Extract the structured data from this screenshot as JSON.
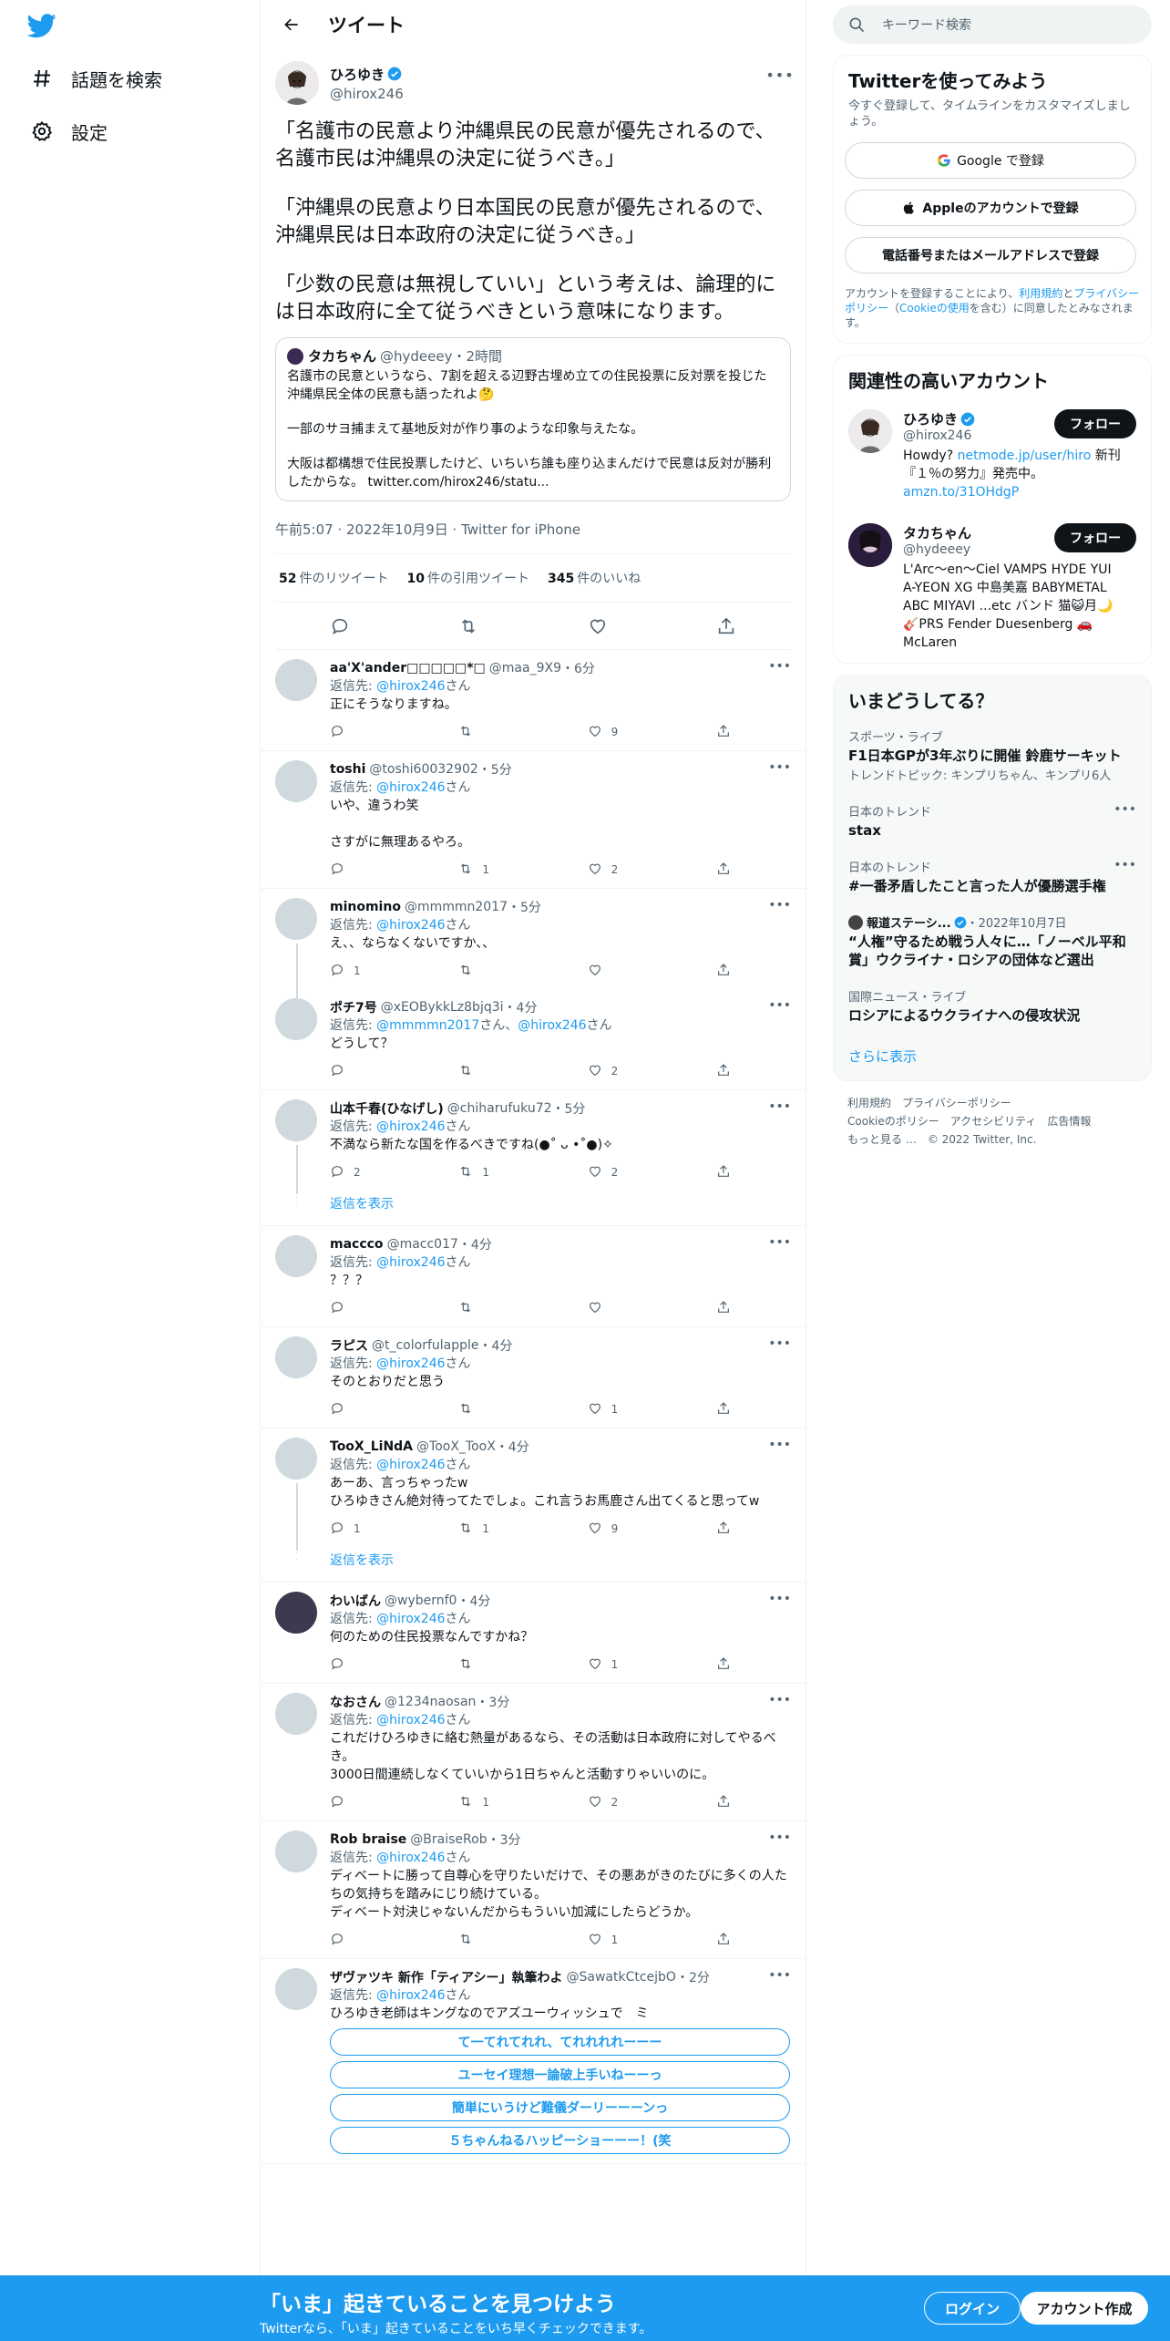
{
  "nav": {
    "items": [
      {
        "label": "話題を検索"
      },
      {
        "label": "設定"
      }
    ]
  },
  "header": {
    "title": "ツイート"
  },
  "focal": {
    "name": "ひろゆき",
    "handle": "@hirox246",
    "paragraphs": [
      "「名護市の民意より沖縄県民の民意が優先されるので、名護市民は沖縄県の決定に従うべき。」",
      "「沖縄県の民意より日本国民の民意が優先されるので、沖縄県民は日本政府の決定に従うべき。」",
      "「少数の民意は無視していい」という考えは、論理的には日本政府に全て従うべきという意味になります。"
    ],
    "quote": {
      "name": "タカちゃん",
      "handle": "@hydeeey",
      "time": "・2時間",
      "p1": "名護市の民意というなら、7割を超える辺野古埋め立ての住民投票に反対票を投じた沖縄県民全体の民意も語ったれよ🤔",
      "p2": "一部のサヨ捕まえて基地反対が作り事のような印象与えたな。",
      "p3": "大阪は都構想で住民投票したけど、いちいち誰も座り込まんだけで民意は反対が勝利したからな。 twitter.com/hirox246/statu..."
    },
    "timestamp": "午前5:07 · 2022年10月9日 · Twitter for iPhone",
    "retweets": "52",
    "retweets_label": "件のリツイート",
    "quotes": "10",
    "quotes_label": "件の引用ツイート",
    "likes": "345",
    "likes_label": "件のいいね"
  },
  "reply_to_label": "返信先:",
  "san": "さん",
  "show_replies": "返信を表示",
  "replies": [
    {
      "name": "aa'X'ander□□□□□*□",
      "handle": "@maa_9X9",
      "time": "・6分",
      "to": "@hirox246",
      "text": "正にそうなりますね。",
      "reply": "",
      "retweet": "",
      "like": "9"
    },
    {
      "name": "toshi",
      "handle": "@toshi60032902",
      "time": "・5分",
      "to": "@hirox246",
      "text": "いや、違うわ笑\n\nさすがに無理あるやろ。",
      "reply": "",
      "retweet": "1",
      "like": "2"
    },
    {
      "name": "minomino",
      "handle": "@mmmmn2017",
      "time": "・5分",
      "to": "@hirox246",
      "text": "え、、ならなくないですか、、",
      "reply": "1",
      "retweet": "",
      "like": ""
    },
    {
      "name": "ポチ7号",
      "handle": "@xEOBykkLz8bjq3i",
      "time": "・4分",
      "to": "@mmmmn2017",
      "to2": "@hirox246",
      "text": "どうして？",
      "reply": "",
      "retweet": "",
      "like": "2"
    },
    {
      "name": "山本千春(ひなげし)",
      "handle": "@chiharufuku72",
      "time": "・5分",
      "to": "@hirox246",
      "text": "不満なら新たな国を作るべきですね(●˚ ᴗ •˚●)✧",
      "reply": "2",
      "retweet": "1",
      "like": "2"
    },
    {
      "name": "maccco",
      "handle": "@macc017",
      "time": "・4分",
      "to": "@hirox246",
      "text": "？？？",
      "reply": "",
      "retweet": "",
      "like": ""
    },
    {
      "name": "ラピス",
      "handle": "@t_colorfulapple",
      "time": "・4分",
      "to": "@hirox246",
      "text": "そのとおりだと思う",
      "reply": "",
      "retweet": "",
      "like": "1"
    },
    {
      "name": "TooX_LiNdA",
      "handle": "@TooX_TooX",
      "time": "・4分",
      "to": "@hirox246",
      "text": "あーあ、言っちゃったw\nひろゆきさん絶対待ってたでしょ。これ言うお馬鹿さん出てくると思ってw",
      "reply": "1",
      "retweet": "1",
      "like": "9"
    },
    {
      "name": "わいばん",
      "handle": "@wybernf0",
      "time": "・4分",
      "to": "@hirox246",
      "text": "何のための住民投票なんですかね？",
      "reply": "",
      "retweet": "",
      "like": "1"
    },
    {
      "name": "なおさん",
      "handle": "@1234naosan",
      "time": "・3分",
      "to": "@hirox246",
      "text": "これだけひろゆきに絡む熱量があるなら、その活動は日本政府に対してやるべき。\n3000日間連続しなくていいから1日ちゃんと活動すりゃいいのに。",
      "reply": "",
      "retweet": "1",
      "like": "2"
    },
    {
      "name": "Rob braise",
      "handle": "@BraiseRob",
      "time": "・3分",
      "to": "@hirox246",
      "text": "ディベートに勝って自尊心を守りたいだけで、その悪あがきのたびに多くの人たちの気持ちを踏みにじり続けている。\nディベート対決じゃないんだからもういい加減にしたらどうか。",
      "reply": "",
      "retweet": "",
      "like": "1"
    },
    {
      "name": "ザヴァツキ 新作「ティアシー」執筆わよ",
      "handle": "@SawatkCtcejbO",
      "time": "・2分",
      "to": "@hirox246",
      "text": "ひろゆき老師はキングなのでアズユーウィッシュで　ミ",
      "reply": "",
      "retweet": "",
      "like": ""
    }
  ],
  "poll_options": [
    "て一てれてれれ、てれれれれーーー",
    "ユーセイ理想一論破上手いねーーっ",
    "簡単にいうけど難儀ダーリーーーンっ",
    "５ちゃんねるハッピーショーーー！(笑"
  ],
  "search": {
    "placeholder": "キーワード検索"
  },
  "signup": {
    "title": "Twitterを使ってみよう",
    "sub": "今すぐ登録して、タイムラインをカスタマイズしましょう。",
    "google": "Google で登録",
    "apple": "Appleのアカウントで登録",
    "phone": "電話番号またはメールアドレスで登録",
    "terms_pre": "アカウントを登録することにより、",
    "terms_link1": "利用規約",
    "terms_mid": "と",
    "terms_link2": "プライバシーポリシー",
    "terms_mid2": "（",
    "terms_link3": "Cookieの使用",
    "terms_post": "を含む）に同意したとみなされます。"
  },
  "related": {
    "title": "関連性の高いアカウント",
    "follow": "フォロー",
    "accounts": [
      {
        "name": "ひろゆき",
        "handle": "@hirox246",
        "bio_pre": "Howdy? ",
        "bio_link": "netmode.jp/user/hiro",
        "bio_mid": " 新刊『１％の努力』発売中。",
        "bio_link2": "amzn.to/31OHdgP"
      },
      {
        "name": "タカちゃん",
        "handle": "@hydeeey",
        "bio": "L'Arc〜en〜Ciel VAMPS HYDE YUI A-YEON XG 中島美嘉 BABYMETAL ABC MIYAVI ...etc バンド 猫😺月🌙🎸PRS Fender Duesenberg 🚗McLaren"
      }
    ]
  },
  "trends": {
    "title": "いまどうしてる？",
    "items": [
      {
        "meta": "スポーツ・ライブ",
        "title": "F1日本GPが3年ぶりに開催 鈴鹿サーキット",
        "sub": "トレンドトピック: キンプリちゃん、キンプリ6人"
      },
      {
        "meta": "日本のトレンド",
        "title": "stax"
      },
      {
        "meta": "日本のトレンド",
        "title": "#一番矛盾したこと言った人が優勝選手権"
      },
      {
        "meta_src": "報道ステーシ...",
        "meta_date": "・2022年10月7日",
        "title": "“人権”守るため戦う人々に…「ノーベル平和賞」ウクライナ・ロシアの団体など選出"
      },
      {
        "meta": "国際ニュース・ライブ",
        "title": "ロシアによるウクライナへの侵攻状況"
      }
    ],
    "show_more": "さらに表示"
  },
  "footer": {
    "links": [
      "利用規約",
      "プライバシーポリシー",
      "Cookieのポリシー",
      "アクセシビリティ",
      "広告情報",
      "もっと見る …",
      "© 2022 Twitter, Inc."
    ]
  },
  "bottom": {
    "title": "「いま」起きていることを見つけよう",
    "sub": "Twitterなら、「いま」起きていることをいち早くチェックできます。",
    "login": "ログイン",
    "signup": "アカウント作成"
  },
  "colors": {
    "accent": "#1d9bf0",
    "text": "#0f1419",
    "secondary": "#536471"
  }
}
